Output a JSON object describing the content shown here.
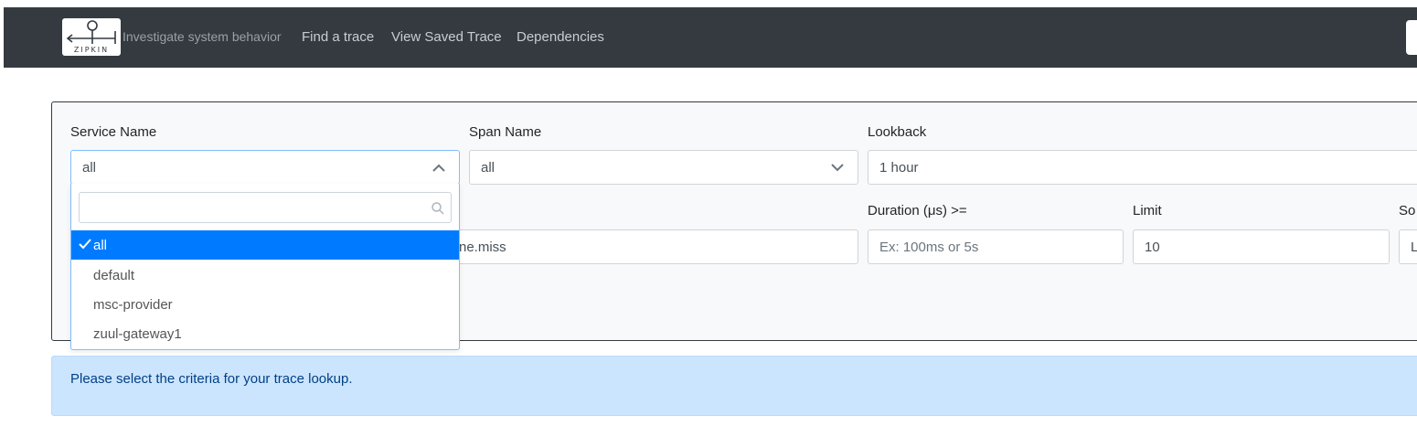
{
  "header": {
    "logo_text": "ZIPKIN",
    "tagline": "Investigate system behavior",
    "nav": {
      "find": "Find a trace",
      "saved": "View Saved Trace",
      "deps": "Dependencies"
    }
  },
  "form": {
    "service_label": "Service Name",
    "service_value": "all",
    "span_label": "Span Name",
    "span_value": "all",
    "lookback_label": "Lookback",
    "lookback_value": "1 hour",
    "annotation_partial": "ne.miss",
    "duration_label": "Duration (μs) >=",
    "duration_placeholder": "Ex: 100ms or 5s",
    "limit_label": "Limit",
    "limit_value": "10",
    "sort_label_partial": "So",
    "sort_value_partial": "L"
  },
  "dropdown": {
    "search_value": "",
    "options": [
      "all",
      "default",
      "msc-provider",
      "zuul-gateway1"
    ],
    "selected": "all"
  },
  "alert": {
    "text": "Please select the criteria for your trace lookup."
  },
  "colors": {
    "navbar": "#343a40",
    "selected": "#007bff",
    "alert_bg": "#cce5ff"
  }
}
